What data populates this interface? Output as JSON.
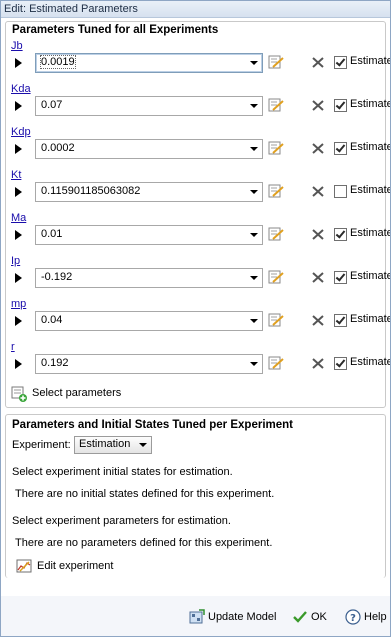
{
  "window": {
    "title": "Edit: Estimated Parameters"
  },
  "tuned_all": {
    "title": "Parameters Tuned for all Experiments",
    "estimate_label": "Estimate",
    "params": [
      {
        "name": "Jb",
        "value": "0.0019",
        "estimate": true
      },
      {
        "name": "Kda",
        "value": "0.07",
        "estimate": true
      },
      {
        "name": "Kdp",
        "value": "0.0002",
        "estimate": true
      },
      {
        "name": "Kt",
        "value": "0.115901185063082",
        "estimate": false
      },
      {
        "name": "Ma",
        "value": "0.01",
        "estimate": true
      },
      {
        "name": "Ip",
        "value": "-0.192",
        "estimate": true
      },
      {
        "name": "mp",
        "value": "0.04",
        "estimate": true
      },
      {
        "name": "r",
        "value": "0.192",
        "estimate": true
      }
    ],
    "select_parameters_label": "Select parameters"
  },
  "tuned_per_experiment": {
    "title": "Parameters and Initial States Tuned per Experiment",
    "experiment_label": "Experiment:",
    "experiment_value": "Estimation",
    "states_prompt": "Select experiment initial states for estimation.",
    "states_empty": "There are no initial states defined for this experiment.",
    "params_prompt": "Select experiment parameters for estimation.",
    "params_empty": "There are no parameters defined for this experiment.",
    "edit_experiment_label": "Edit experiment"
  },
  "buttons": {
    "update_model": "Update Model",
    "ok": "OK",
    "help": "Help"
  }
}
